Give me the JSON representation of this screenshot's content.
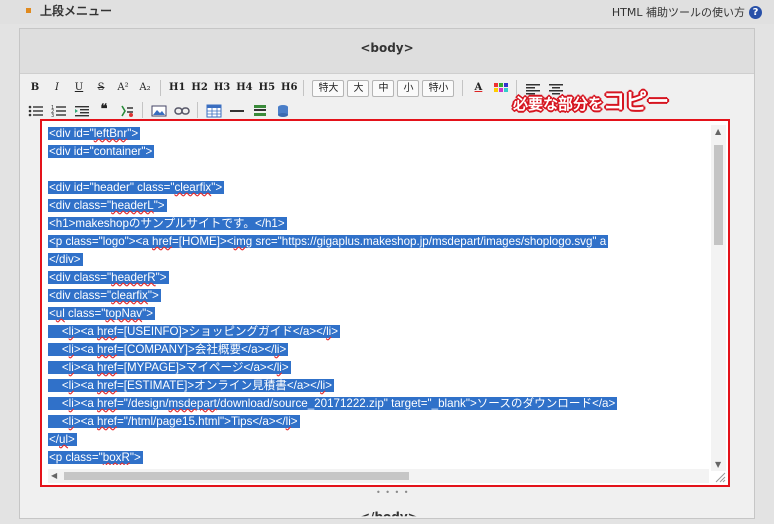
{
  "header": {
    "section_title": "上段メニュー",
    "help_link": "HTML 補助ツールの使い方",
    "help_icon_label": "?"
  },
  "editor": {
    "tag_title": "<body>",
    "next_tag_title": "</body>",
    "annotation_part1": "必要な部分を",
    "annotation_part2": "コピー",
    "highlight_color": "#3071c9",
    "annotation_color": "#d61520"
  },
  "toolbar": {
    "bold": "B",
    "italic": "I",
    "underline": "U",
    "strike": "S",
    "superscript": "A²",
    "subscript": "A₂",
    "headings": [
      "H1",
      "H2",
      "H3",
      "H4",
      "H5",
      "H6"
    ],
    "sizes": [
      "特大",
      "大",
      "中",
      "小",
      "特小"
    ],
    "font_color": "A",
    "quote": "❝"
  },
  "code_lines": [
    [
      {
        "t": "<div id=\""
      },
      {
        "t": "leftBnr",
        "sq": true
      },
      {
        "t": "\">"
      }
    ],
    [
      {
        "t": "<div id=\"container\">"
      }
    ],
    [],
    [
      {
        "t": "<div id=\"header\" class=\""
      },
      {
        "t": "clearfix",
        "sq": true
      },
      {
        "t": "\">"
      }
    ],
    [
      {
        "t": "<div class=\""
      },
      {
        "t": "headerL",
        "sq": true
      },
      {
        "t": "\">"
      }
    ],
    [
      {
        "t": "<h1>makeshopのサンプルサイトです。</h1>"
      }
    ],
    [
      {
        "t": "<p class=\"logo\"><a "
      },
      {
        "t": "href",
        "sq": true
      },
      {
        "t": "=[HOME]><"
      },
      {
        "t": "img",
        "sq": true
      },
      {
        "t": " src=\"https://gigaplus.makeshop.jp/msdepart/images/shoplogo.svg\" a"
      }
    ],
    [
      {
        "t": "</div>"
      }
    ],
    [
      {
        "t": "<div class=\""
      },
      {
        "t": "headerR",
        "sq": true
      },
      {
        "t": "\">"
      }
    ],
    [
      {
        "t": "<div class=\""
      },
      {
        "t": "clearfix",
        "sq": true
      },
      {
        "t": "\">"
      }
    ],
    [
      {
        "t": "<"
      },
      {
        "t": "ul",
        "sq": true
      },
      {
        "t": " class=\""
      },
      {
        "t": "topNav",
        "sq": true
      },
      {
        "t": "\">"
      }
    ],
    [
      {
        "t": "    <"
      },
      {
        "t": "li",
        "sq": true
      },
      {
        "t": "><a "
      },
      {
        "t": "href",
        "sq": true
      },
      {
        "t": "=[USEINFO]>ショッピングガイド</a></"
      },
      {
        "t": "li",
        "sq": true
      },
      {
        "t": ">"
      }
    ],
    [
      {
        "t": "    <"
      },
      {
        "t": "li",
        "sq": true
      },
      {
        "t": "><a "
      },
      {
        "t": "href",
        "sq": true
      },
      {
        "t": "=[COMPANY]>会社概要</a></"
      },
      {
        "t": "li",
        "sq": true
      },
      {
        "t": ">"
      }
    ],
    [
      {
        "t": "    <"
      },
      {
        "t": "li",
        "sq": true
      },
      {
        "t": "><a "
      },
      {
        "t": "href",
        "sq": true
      },
      {
        "t": "=[MYPAGE]>マイページ</a></"
      },
      {
        "t": "li",
        "sq": true
      },
      {
        "t": ">"
      }
    ],
    [
      {
        "t": "    <"
      },
      {
        "t": "li",
        "sq": true
      },
      {
        "t": "><a "
      },
      {
        "t": "href",
        "sq": true
      },
      {
        "t": "=[ESTIMATE]>オンライン見積書</a></"
      },
      {
        "t": "li",
        "sq": true
      },
      {
        "t": ">"
      }
    ],
    [
      {
        "t": "    <"
      },
      {
        "t": "li",
        "sq": true
      },
      {
        "t": "><a "
      },
      {
        "t": "href",
        "sq": true
      },
      {
        "t": "=\"/design/"
      },
      {
        "t": "msdepart",
        "sq": true
      },
      {
        "t": "/download/source_20171222.zip\" target=\"_blank\">ソースのダウンロード</a>"
      }
    ],
    [
      {
        "t": "    <"
      },
      {
        "t": "li",
        "sq": true
      },
      {
        "t": "><a "
      },
      {
        "t": "href",
        "sq": true
      },
      {
        "t": "=\"/html/page15.html\">Tips</a></"
      },
      {
        "t": "li",
        "sq": true
      },
      {
        "t": ">"
      }
    ],
    [
      {
        "t": "</"
      },
      {
        "t": "ul",
        "sq": true
      },
      {
        "t": ">"
      }
    ],
    [
      {
        "t": "<p class=\""
      },
      {
        "t": "boxR",
        "sq": true
      },
      {
        "t": "\">"
      }
    ]
  ]
}
